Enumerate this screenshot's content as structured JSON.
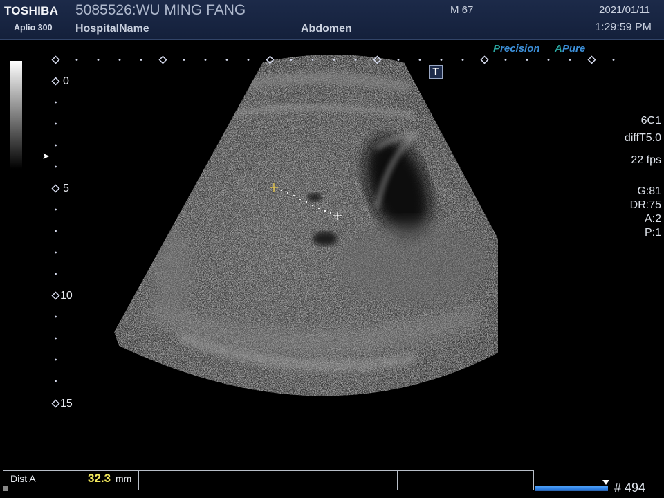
{
  "header": {
    "brand": "TOSHIBA",
    "model": "Aplio 300",
    "patient_id_name": "5085526:WU MING FANG",
    "hospital": "HospitalName",
    "gender_age": "M 67",
    "exam": "Abdomen",
    "date": "2021/01/11",
    "time": "1:29:59 PM"
  },
  "logos": {
    "precision_initial": "P",
    "precision_rest": "recision",
    "apure_initial": "A",
    "apure_rest": "Pure"
  },
  "transducer_marker": "T",
  "right_panel": {
    "probe": "6C1",
    "preset": "diffT5.0",
    "frame_rate": "22 fps",
    "gain": "G:81",
    "dynamic_range": "DR:75",
    "a_setting": "A:2",
    "p_setting": "P:1"
  },
  "depth_scale": {
    "labels": [
      "0",
      "5",
      "10",
      "15"
    ]
  },
  "focus_marker": "➤",
  "measurement": {
    "label": "Dist A",
    "value": "32.3",
    "unit": "mm"
  },
  "cine": {
    "progress": 1.0,
    "frame_label": "# 494"
  },
  "colors": {
    "header_bg": "#1c2a49",
    "scale_marker": "#d8ddf0",
    "caliper": "#e8c84a",
    "measurement_value": "#f2e85c",
    "cine_fill": "#2f86ee"
  }
}
